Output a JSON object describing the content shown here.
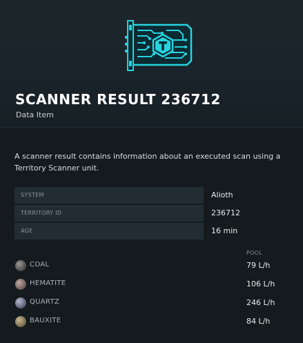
{
  "item": {
    "icon": "territory-scanner-result-icon",
    "title": "SCANNER RESULT 236712",
    "category": "Data Item",
    "accent_color": "#27d3e0"
  },
  "description": "A scanner result contains information about an executed scan using a Territory Scanner unit.",
  "stats": [
    {
      "label": "SYSTEM",
      "value": "Alioth"
    },
    {
      "label": "TERRITORY ID",
      "value": "236712"
    },
    {
      "label": "AGE",
      "value": "16 min"
    }
  ],
  "ores": {
    "pool_header": "POOL",
    "items": [
      {
        "name": "COAL",
        "pool": "79 L/h",
        "icon": "coal-ore-icon",
        "color": "#6e6c6a"
      },
      {
        "name": "HEMATITE",
        "pool": "106 L/h",
        "icon": "hematite-ore-icon",
        "color": "#8c7a76"
      },
      {
        "name": "QUARTZ",
        "pool": "246 L/h",
        "icon": "quartz-ore-icon",
        "color": "#7a7e96"
      },
      {
        "name": "BAUXITE",
        "pool": "84 L/h",
        "icon": "bauxite-ore-icon",
        "color": "#8f8468"
      }
    ]
  }
}
